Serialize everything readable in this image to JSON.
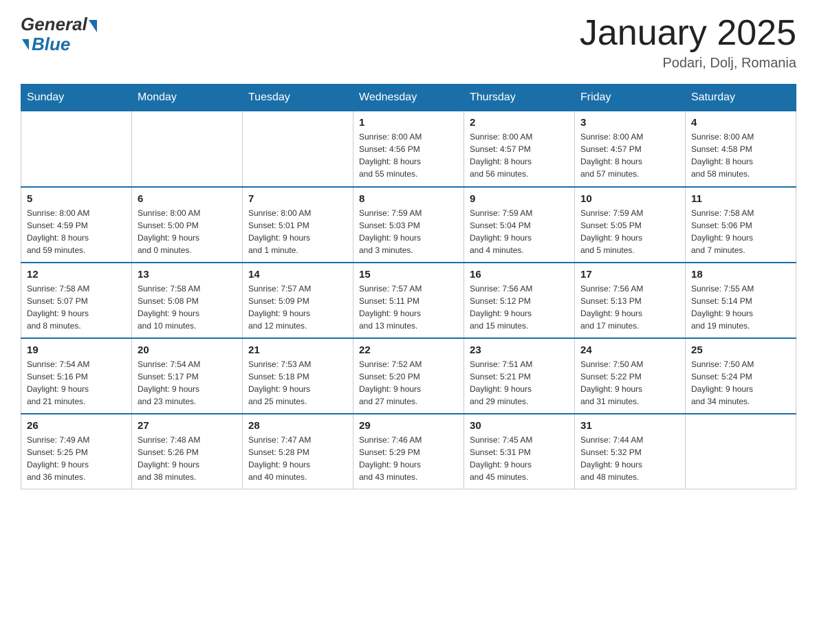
{
  "logo": {
    "general": "General",
    "blue": "Blue",
    "tagline": "Blue"
  },
  "header": {
    "title": "January 2025",
    "subtitle": "Podari, Dolj, Romania"
  },
  "days_of_week": [
    "Sunday",
    "Monday",
    "Tuesday",
    "Wednesday",
    "Thursday",
    "Friday",
    "Saturday"
  ],
  "weeks": [
    [
      {
        "day": "",
        "info": ""
      },
      {
        "day": "",
        "info": ""
      },
      {
        "day": "",
        "info": ""
      },
      {
        "day": "1",
        "info": "Sunrise: 8:00 AM\nSunset: 4:56 PM\nDaylight: 8 hours\nand 55 minutes."
      },
      {
        "day": "2",
        "info": "Sunrise: 8:00 AM\nSunset: 4:57 PM\nDaylight: 8 hours\nand 56 minutes."
      },
      {
        "day": "3",
        "info": "Sunrise: 8:00 AM\nSunset: 4:57 PM\nDaylight: 8 hours\nand 57 minutes."
      },
      {
        "day": "4",
        "info": "Sunrise: 8:00 AM\nSunset: 4:58 PM\nDaylight: 8 hours\nand 58 minutes."
      }
    ],
    [
      {
        "day": "5",
        "info": "Sunrise: 8:00 AM\nSunset: 4:59 PM\nDaylight: 8 hours\nand 59 minutes."
      },
      {
        "day": "6",
        "info": "Sunrise: 8:00 AM\nSunset: 5:00 PM\nDaylight: 9 hours\nand 0 minutes."
      },
      {
        "day": "7",
        "info": "Sunrise: 8:00 AM\nSunset: 5:01 PM\nDaylight: 9 hours\nand 1 minute."
      },
      {
        "day": "8",
        "info": "Sunrise: 7:59 AM\nSunset: 5:03 PM\nDaylight: 9 hours\nand 3 minutes."
      },
      {
        "day": "9",
        "info": "Sunrise: 7:59 AM\nSunset: 5:04 PM\nDaylight: 9 hours\nand 4 minutes."
      },
      {
        "day": "10",
        "info": "Sunrise: 7:59 AM\nSunset: 5:05 PM\nDaylight: 9 hours\nand 5 minutes."
      },
      {
        "day": "11",
        "info": "Sunrise: 7:58 AM\nSunset: 5:06 PM\nDaylight: 9 hours\nand 7 minutes."
      }
    ],
    [
      {
        "day": "12",
        "info": "Sunrise: 7:58 AM\nSunset: 5:07 PM\nDaylight: 9 hours\nand 8 minutes."
      },
      {
        "day": "13",
        "info": "Sunrise: 7:58 AM\nSunset: 5:08 PM\nDaylight: 9 hours\nand 10 minutes."
      },
      {
        "day": "14",
        "info": "Sunrise: 7:57 AM\nSunset: 5:09 PM\nDaylight: 9 hours\nand 12 minutes."
      },
      {
        "day": "15",
        "info": "Sunrise: 7:57 AM\nSunset: 5:11 PM\nDaylight: 9 hours\nand 13 minutes."
      },
      {
        "day": "16",
        "info": "Sunrise: 7:56 AM\nSunset: 5:12 PM\nDaylight: 9 hours\nand 15 minutes."
      },
      {
        "day": "17",
        "info": "Sunrise: 7:56 AM\nSunset: 5:13 PM\nDaylight: 9 hours\nand 17 minutes."
      },
      {
        "day": "18",
        "info": "Sunrise: 7:55 AM\nSunset: 5:14 PM\nDaylight: 9 hours\nand 19 minutes."
      }
    ],
    [
      {
        "day": "19",
        "info": "Sunrise: 7:54 AM\nSunset: 5:16 PM\nDaylight: 9 hours\nand 21 minutes."
      },
      {
        "day": "20",
        "info": "Sunrise: 7:54 AM\nSunset: 5:17 PM\nDaylight: 9 hours\nand 23 minutes."
      },
      {
        "day": "21",
        "info": "Sunrise: 7:53 AM\nSunset: 5:18 PM\nDaylight: 9 hours\nand 25 minutes."
      },
      {
        "day": "22",
        "info": "Sunrise: 7:52 AM\nSunset: 5:20 PM\nDaylight: 9 hours\nand 27 minutes."
      },
      {
        "day": "23",
        "info": "Sunrise: 7:51 AM\nSunset: 5:21 PM\nDaylight: 9 hours\nand 29 minutes."
      },
      {
        "day": "24",
        "info": "Sunrise: 7:50 AM\nSunset: 5:22 PM\nDaylight: 9 hours\nand 31 minutes."
      },
      {
        "day": "25",
        "info": "Sunrise: 7:50 AM\nSunset: 5:24 PM\nDaylight: 9 hours\nand 34 minutes."
      }
    ],
    [
      {
        "day": "26",
        "info": "Sunrise: 7:49 AM\nSunset: 5:25 PM\nDaylight: 9 hours\nand 36 minutes."
      },
      {
        "day": "27",
        "info": "Sunrise: 7:48 AM\nSunset: 5:26 PM\nDaylight: 9 hours\nand 38 minutes."
      },
      {
        "day": "28",
        "info": "Sunrise: 7:47 AM\nSunset: 5:28 PM\nDaylight: 9 hours\nand 40 minutes."
      },
      {
        "day": "29",
        "info": "Sunrise: 7:46 AM\nSunset: 5:29 PM\nDaylight: 9 hours\nand 43 minutes."
      },
      {
        "day": "30",
        "info": "Sunrise: 7:45 AM\nSunset: 5:31 PM\nDaylight: 9 hours\nand 45 minutes."
      },
      {
        "day": "31",
        "info": "Sunrise: 7:44 AM\nSunset: 5:32 PM\nDaylight: 9 hours\nand 48 minutes."
      },
      {
        "day": "",
        "info": ""
      }
    ]
  ]
}
